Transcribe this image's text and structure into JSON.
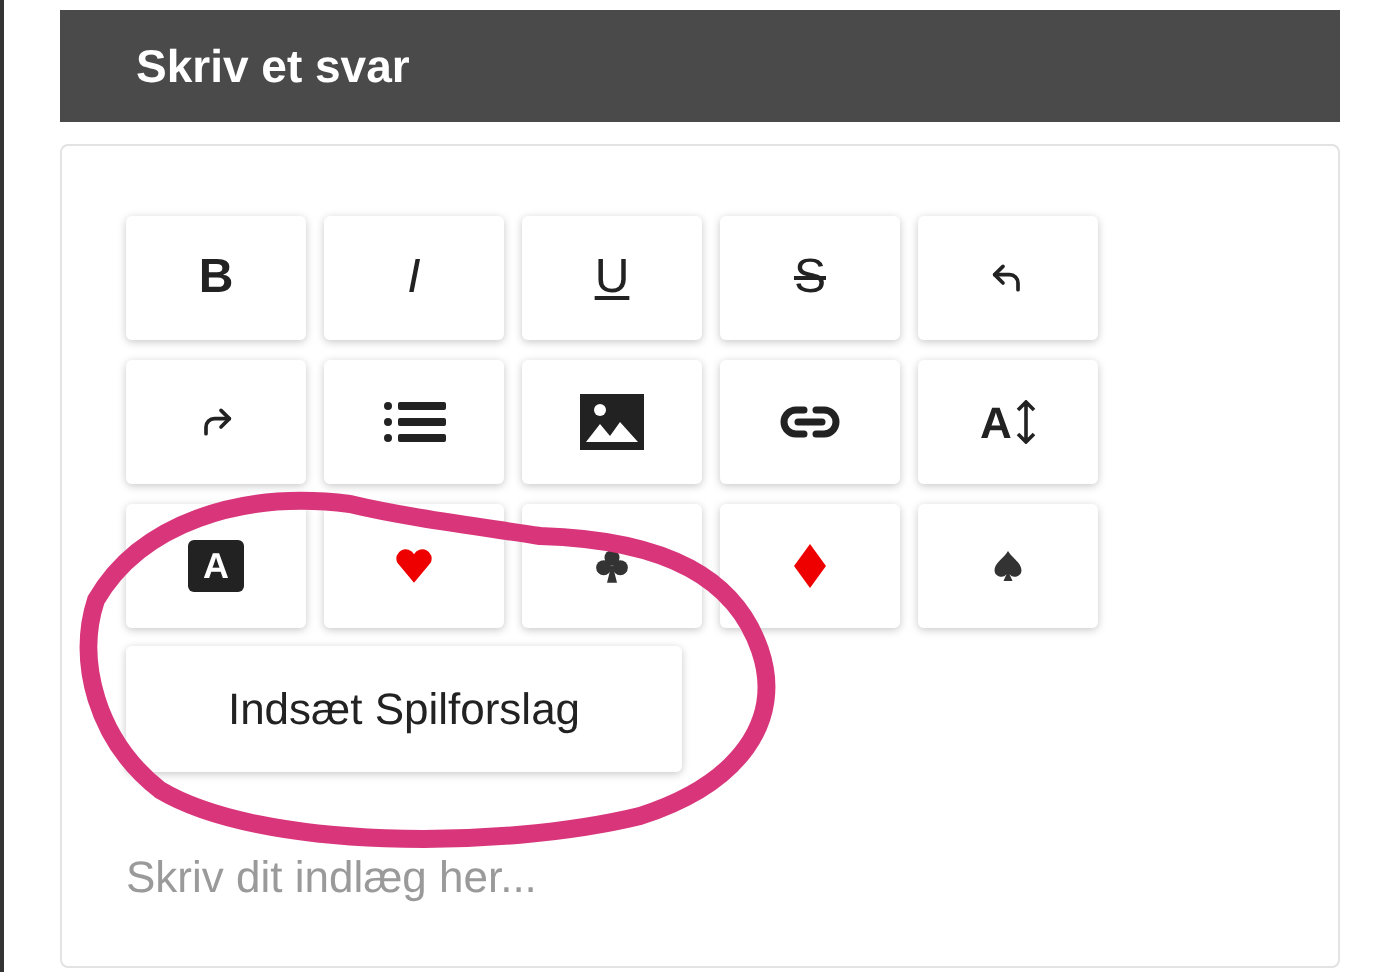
{
  "header": {
    "title": "Skriv et svar"
  },
  "toolbar": [
    {
      "kind": "bold",
      "label": "B"
    },
    {
      "kind": "italic",
      "label": "I"
    },
    {
      "kind": "underline",
      "label": "U"
    },
    {
      "kind": "strike",
      "label": "S"
    },
    {
      "kind": "undo"
    },
    {
      "kind": "redo"
    },
    {
      "kind": "list"
    },
    {
      "kind": "image"
    },
    {
      "kind": "link"
    },
    {
      "kind": "fontsize",
      "label": "A"
    },
    {
      "kind": "highlight",
      "label": "A"
    },
    {
      "kind": "heart"
    },
    {
      "kind": "club"
    },
    {
      "kind": "diamond"
    },
    {
      "kind": "spade"
    }
  ],
  "suggest_button": {
    "label": "Indsæt Spilforslag"
  },
  "editor": {
    "placeholder": "Skriv dit indlæg her..."
  }
}
